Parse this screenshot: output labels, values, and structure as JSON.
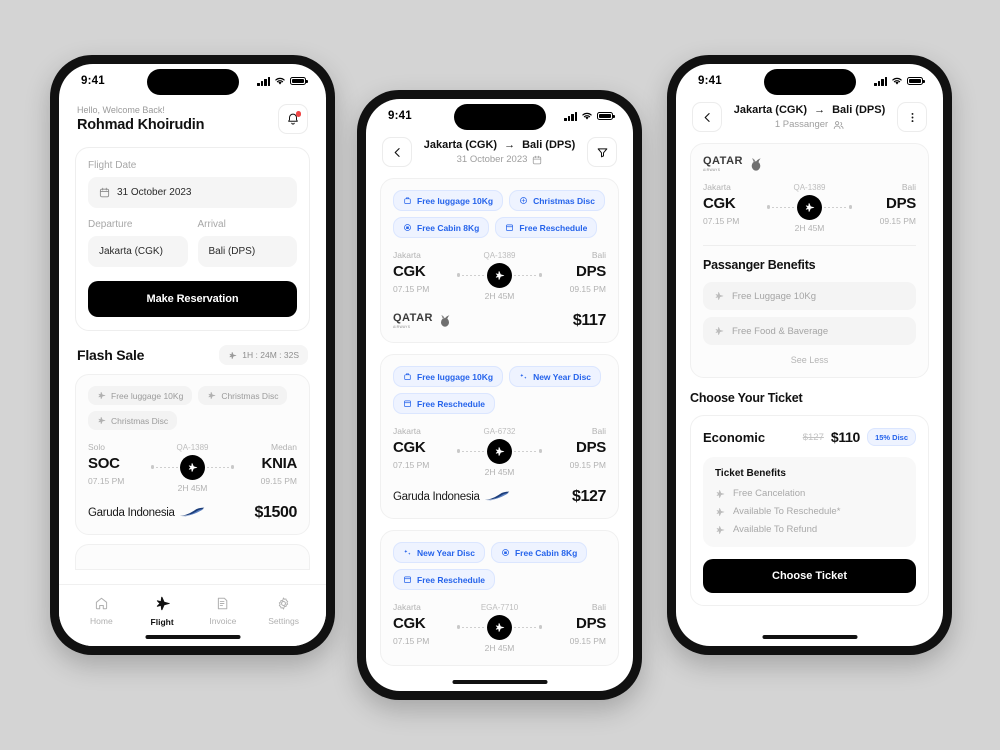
{
  "status_bar": {
    "time": "9:41"
  },
  "phone1": {
    "greeting": "Hello, Welcome Back!",
    "user_name": "Rohmad Khoirudin",
    "notification_icon": "bell-icon",
    "form": {
      "flight_date_label": "Flight Date",
      "flight_date_value": "31 October 2023",
      "calendar_icon": "calendar-icon",
      "departure_label": "Departure",
      "departure_value": "Jakarta (CGK)",
      "arrival_label": "Arrival",
      "arrival_value": "Bali (DPS)",
      "submit_label": "Make Reservation"
    },
    "flash_sale": {
      "title": "Flash Sale",
      "timer": "1H : 24M : 32S",
      "timer_icon": "plane-icon",
      "card": {
        "chips": [
          "Free luggage 10Kg",
          "Christmas Disc",
          "Christmas Disc"
        ],
        "from_city": "Solo",
        "from_code": "SOC",
        "from_time": "07.15 PM",
        "flight_no": "QA-1389",
        "duration": "2H 45M",
        "to_city": "Medan",
        "to_code": "KNIA",
        "to_time": "09.15 PM",
        "airline": "Garuda Indonesia",
        "price": "$1500"
      }
    },
    "tabs": [
      {
        "label": "Home",
        "icon": "home-icon",
        "active": false
      },
      {
        "label": "Flight",
        "icon": "plane-icon",
        "active": true
      },
      {
        "label": "Invoice",
        "icon": "invoice-icon",
        "active": false
      },
      {
        "label": "Settings",
        "icon": "gear-icon",
        "active": false
      }
    ]
  },
  "phone2": {
    "back_icon": "arrow-left-icon",
    "filter_icon": "filter-icon",
    "route_from": "Jakarta (CGK)",
    "route_arrow": "→",
    "route_to": "Bali (DPS)",
    "date": "31 October 2023",
    "calendar_icon": "calendar-icon",
    "flights": [
      {
        "chips": [
          "Free luggage 10Kg",
          "Christmas Disc",
          "Free Cabin 8Kg",
          "Free Reschedule"
        ],
        "chip_icons": [
          "luggage-icon",
          "snowflake-icon",
          "cabin-bag-icon",
          "calendar-icon"
        ],
        "from_city": "Jakarta",
        "from_code": "CGK",
        "from_time": "07.15 PM",
        "flight_no": "QA-1389",
        "duration": "2H 45M",
        "to_city": "Bali",
        "to_code": "DPS",
        "to_time": "09.15 PM",
        "airline": "Qatar Airways",
        "airline_key": "qatar",
        "price": "$117"
      },
      {
        "chips": [
          "Free luggage 10Kg",
          "New Year Disc",
          "Free Reschedule"
        ],
        "chip_icons": [
          "luggage-icon",
          "sparkle-icon",
          "calendar-icon"
        ],
        "from_city": "Jakarta",
        "from_code": "CGK",
        "from_time": "07.15 PM",
        "flight_no": "GA-6732",
        "duration": "2H 45M",
        "to_city": "Bali",
        "to_code": "DPS",
        "to_time": "09.15 PM",
        "airline": "Garuda Indonesia",
        "airline_key": "garuda",
        "price": "$127"
      },
      {
        "chips": [
          "New Year Disc",
          "Free Cabin 8Kg",
          "Free Reschedule"
        ],
        "chip_icons": [
          "sparkle-icon",
          "cabin-bag-icon",
          "calendar-icon"
        ],
        "from_city": "Jakarta",
        "from_code": "CGK",
        "from_time": "07.15 PM",
        "flight_no": "EGA-7710",
        "duration": "2H 45M",
        "to_city": "Bali",
        "to_code": "DPS",
        "to_time": "09.15 PM",
        "airline": "",
        "airline_key": "none",
        "price": ""
      }
    ]
  },
  "phone3": {
    "back_icon": "arrow-left-icon",
    "menu_icon": "more-vertical-icon",
    "route_from": "Jakarta (CGK)",
    "route_arrow": "→",
    "route_to": "Bali (DPS)",
    "passenger": "1 Passanger",
    "passenger_icon": "people-icon",
    "detail": {
      "airline": "Qatar Airways",
      "from_city": "Jakarta",
      "from_code": "CGK",
      "from_time": "07.15 PM",
      "flight_no": "QA-1389",
      "duration": "2H 45M",
      "to_city": "Bali",
      "to_code": "DPS",
      "to_time": "09.15 PM",
      "benefits_title": "Passanger Benefits",
      "benefits": [
        "Free Luggage 10Kg",
        "Free Food & Baverage"
      ],
      "see_less": "See Less"
    },
    "choose_title": "Choose Your Ticket",
    "ticket": {
      "class": "Economic",
      "old_price": "$127",
      "new_price": "$110",
      "discount": "15% Disc",
      "benefits_title": "Ticket Benefits",
      "benefits": [
        "Free Cancelation",
        "Available To Reschedule*",
        "Available To Refund"
      ],
      "cta": "Choose Ticket"
    }
  },
  "colors": {
    "accent_blue": "#2563eb",
    "chip_blue_bg": "#eef3ff",
    "dark": "#000000",
    "page_bg": "#d4d4d4",
    "notification_dot": "#ef4444"
  }
}
